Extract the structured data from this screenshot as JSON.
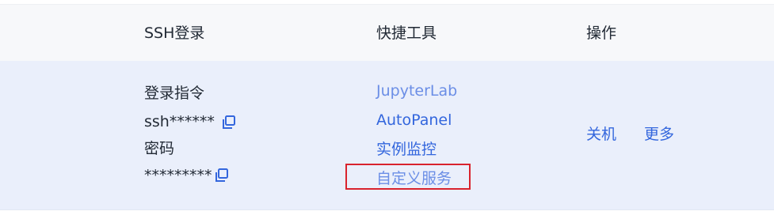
{
  "header": {
    "ssh_login": "SSH登录",
    "quick_tools": "快捷工具",
    "actions": "操作"
  },
  "row": {
    "ssh": {
      "command_label": "登录指令",
      "command_value": "ssh******",
      "password_label": "密码",
      "password_value": "*********"
    },
    "tools": {
      "jupyterlab": "JupyterLab",
      "autopanel": "AutoPanel",
      "monitor": "实例监控",
      "custom_service": "自定义服务"
    },
    "actions": {
      "shutdown": "关机",
      "more": "更多"
    }
  },
  "icons": {
    "copy_command": "copy-icon",
    "copy_password": "copy-icon"
  },
  "colors": {
    "link": "#3366dd",
    "link_light": "#6b8ee6",
    "highlight": "#d9232d",
    "row_background": "#eaeffb",
    "header_background": "#f7f8fa"
  }
}
